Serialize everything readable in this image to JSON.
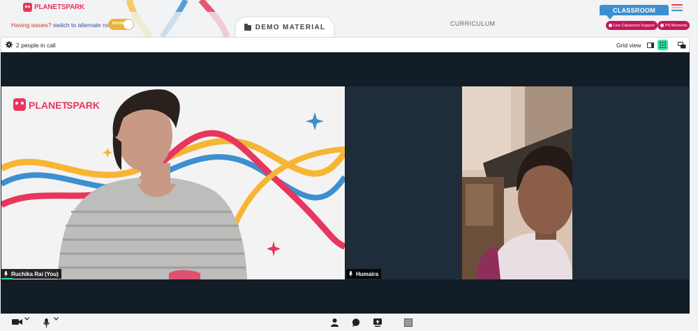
{
  "brand": {
    "logo_text_planet": "PLANET",
    "logo_text_spark": "SPARK"
  },
  "header": {
    "issues_text": "Having issues?",
    "switch_link": "switch to alternate room",
    "room_toggle_label": "ROOM",
    "demo_material_label": "DEMO MATERIAL",
    "curriculum_label": "CURRICULUM",
    "classroom_label": "CLASSROOM",
    "live_support_label": "Live Classroom Support",
    "ps_moments_label": "PS Moments"
  },
  "call": {
    "people_count_text": "2 people in call",
    "grid_view_label": "Grid view"
  },
  "participants": [
    {
      "name": "Ruchika Rai (You)"
    },
    {
      "name": "Humaira"
    }
  ],
  "colors": {
    "accent_red": "#e8365d",
    "classroom_blue": "#3d8fd0",
    "pill_magenta": "#c2185b",
    "active_green": "#2ee6a5",
    "stage_dark": "#121d27",
    "toggle_yellow": "#e8b43a"
  },
  "icons": {
    "settings": "gear-icon",
    "single_view": "speaker-view-icon",
    "grid_view": "grid-view-icon",
    "chat_toggle": "chat-bubbles-icon",
    "camera": "video-camera-icon",
    "mic": "microphone-icon",
    "participants": "person-icon",
    "chat": "chat-icon",
    "screenshare": "screen-share-icon",
    "whiteboard": "whiteboard-icon"
  }
}
